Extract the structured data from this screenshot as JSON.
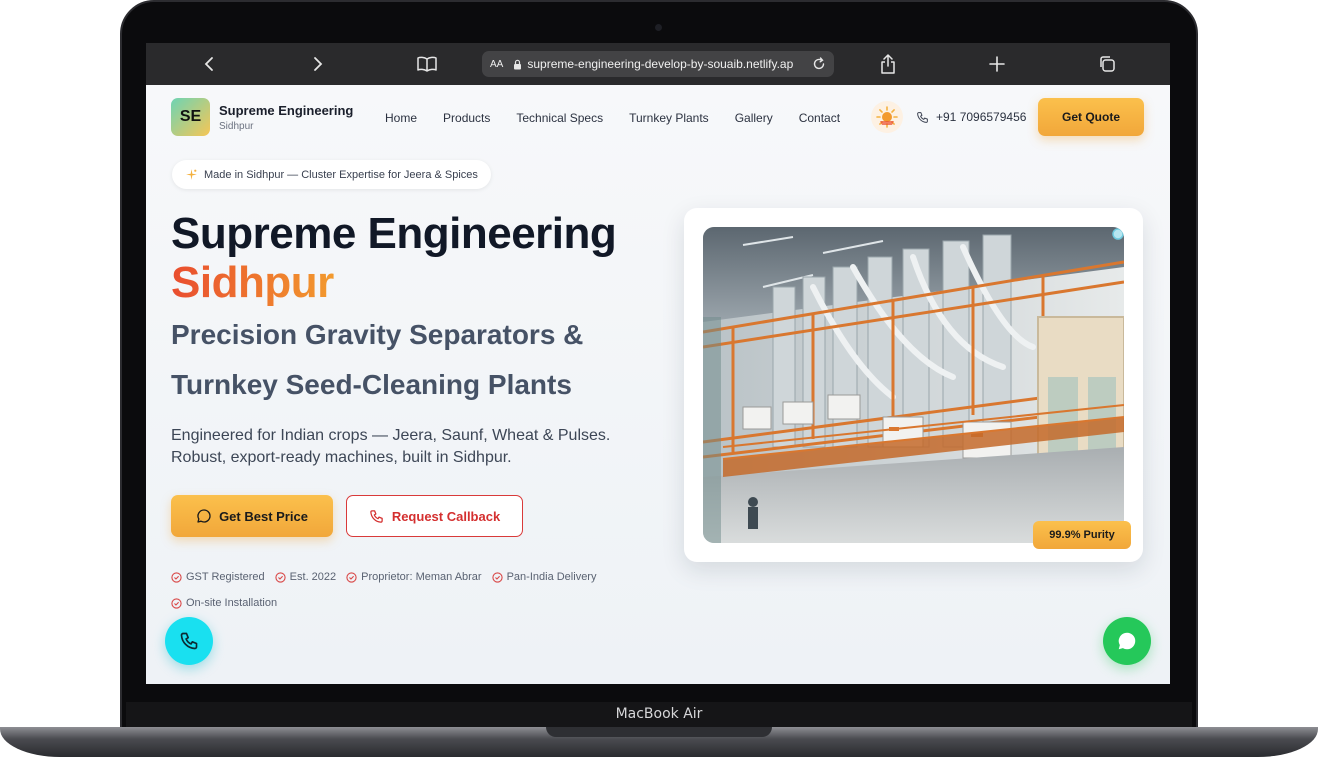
{
  "device": {
    "label": "MacBook Air"
  },
  "browser": {
    "url": "supreme-engineering-develop-by-souaib.netlify.ap",
    "text_size_label": "AA"
  },
  "header": {
    "logo_text": "SE",
    "brand_name": "Supreme Engineering",
    "brand_location": "Sidhpur",
    "nav": [
      "Home",
      "Products",
      "Technical Specs",
      "Turnkey Plants",
      "Gallery",
      "Contact"
    ],
    "phone": "+91 7096579456",
    "quote_label": "Get Quote"
  },
  "hero": {
    "badge": "Made in Sidhpur — Cluster Expertise for Jeera & Spices",
    "title_line1": "Supreme Engineering",
    "title_line2": "Sidhpur",
    "subtitle_line1": "Precision Gravity Separators &",
    "subtitle_line2": "Turnkey Seed-Cleaning Plants",
    "description": "Engineered for Indian crops — Jeera, Saunf, Wheat & Pulses. Robust, export-ready machines, built in Sidhpur.",
    "cta_primary": "Get Best Price",
    "cta_secondary": "Request Callback",
    "trust_items": [
      "GST Registered",
      "Est. 2022",
      "Proprietor: Meman Abrar",
      "Pan-India Delivery",
      "On-site Installation"
    ],
    "image_badge": "99.9% Purity"
  },
  "colors": {
    "accent": "#f4b13f",
    "gradient_start": "#e94d2f",
    "gradient_end": "#f29a2e",
    "callback_red": "#d42f2f",
    "whatsapp_green": "#25c85a",
    "call_cyan": "#19e0f0"
  },
  "icons": {
    "back": "chevron-left-icon",
    "forward": "chevron-right-icon",
    "reader": "book-icon",
    "lock": "lock-icon",
    "reload": "reload-icon",
    "share": "share-icon",
    "new_tab": "plus-icon",
    "tabs": "tabs-icon",
    "phone": "phone-icon",
    "chat": "chat-icon",
    "sparkle": "sparkle-icon",
    "check": "check-circle-icon"
  }
}
